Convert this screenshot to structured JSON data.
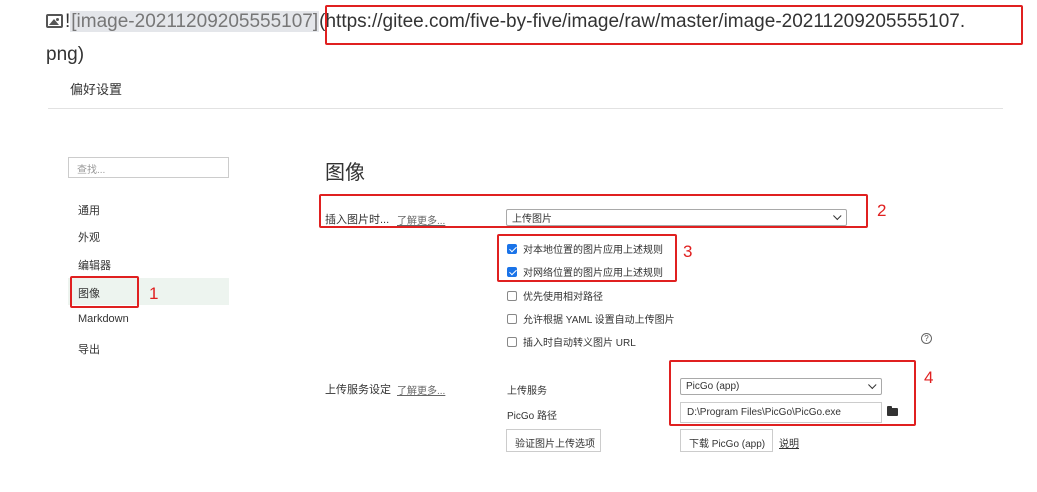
{
  "markdown": {
    "bang": "!",
    "alt_text": "[image-20211209205555107]",
    "url_text": "(https://gitee.com/five-by-five/image/raw/master/image-20211209205555107.",
    "url_cont": "png)"
  },
  "window": {
    "title": "偏好设置"
  },
  "sidebar": {
    "search_placeholder": "查找...",
    "items": [
      {
        "label": "通用"
      },
      {
        "label": "外观"
      },
      {
        "label": "编辑器"
      },
      {
        "label": "图像"
      },
      {
        "label": "Markdown"
      },
      {
        "label": "导出"
      }
    ],
    "active_index": 3
  },
  "image_panel": {
    "heading": "图像",
    "insert_label": "插入图片时...",
    "learn_more": "了解更多...",
    "insert_select_value": "上传图片",
    "checkboxes": [
      {
        "label": "对本地位置的图片应用上述规则",
        "checked": true
      },
      {
        "label": "对网络位置的图片应用上述规则",
        "checked": true
      },
      {
        "label": "优先使用相对路径",
        "checked": false
      },
      {
        "label": "允许根据 YAML 设置自动上传图片",
        "checked": false
      },
      {
        "label": "插入时自动转义图片 URL",
        "checked": false
      }
    ],
    "help_icon": "?",
    "upload_label": "上传服务设定",
    "upload_learn_more": "了解更多...",
    "upload_service_label": "上传服务",
    "upload_service_value": "PicGo (app)",
    "picgo_path_label": "PicGo 路径",
    "picgo_path_value": "D:\\Program Files\\PicGo\\PicGo.exe",
    "verify_button": "验证图片上传选项",
    "download_button": "下载 PicGo (app)",
    "explain_link": "说明"
  },
  "annotations": {
    "n1": "1",
    "n2": "2",
    "n3": "3",
    "n4": "4",
    "color": "#e02020"
  },
  "icons": {
    "image": "image-icon",
    "folder": "folder-icon",
    "help": "help-icon",
    "chevron": "chevron-down-icon",
    "check": "check-icon"
  }
}
